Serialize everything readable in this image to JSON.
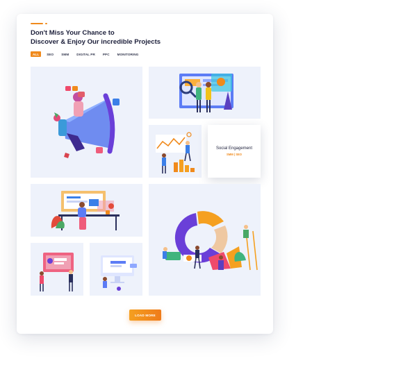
{
  "header": {
    "title_line1": "Don't Miss Your Chance to",
    "title_line2": "Discover & Enjoy Our incredible Projects"
  },
  "filters": [
    {
      "label": "ALL",
      "active": true
    },
    {
      "label": "SEO",
      "active": false
    },
    {
      "label": "SMM",
      "active": false
    },
    {
      "label": "DIGITAL PR",
      "active": false
    },
    {
      "label": "PPC",
      "active": false
    },
    {
      "label": "MONITORING",
      "active": false
    }
  ],
  "projects": [
    {
      "illustration": "megaphone-marketing-illustration"
    },
    {
      "illustration": "analytics-dashboard-team-illustration"
    },
    {
      "illustration": "growth-chart-team-illustration"
    },
    {
      "illustration": "office-workspace-illustration"
    },
    {
      "illustration": "pie-chart-team-illustration"
    },
    {
      "illustration": "presentation-board-illustration"
    },
    {
      "illustration": "desktop-monitor-illustration"
    }
  ],
  "hover_card": {
    "title": "Social Engagement",
    "subtitle": "SMM | SEO"
  },
  "load_more": {
    "label": "LOAD MORE"
  },
  "colors": {
    "accent": "#f08a1c",
    "tile_bg": "#eef2fb",
    "heading": "#1c1f3a"
  }
}
